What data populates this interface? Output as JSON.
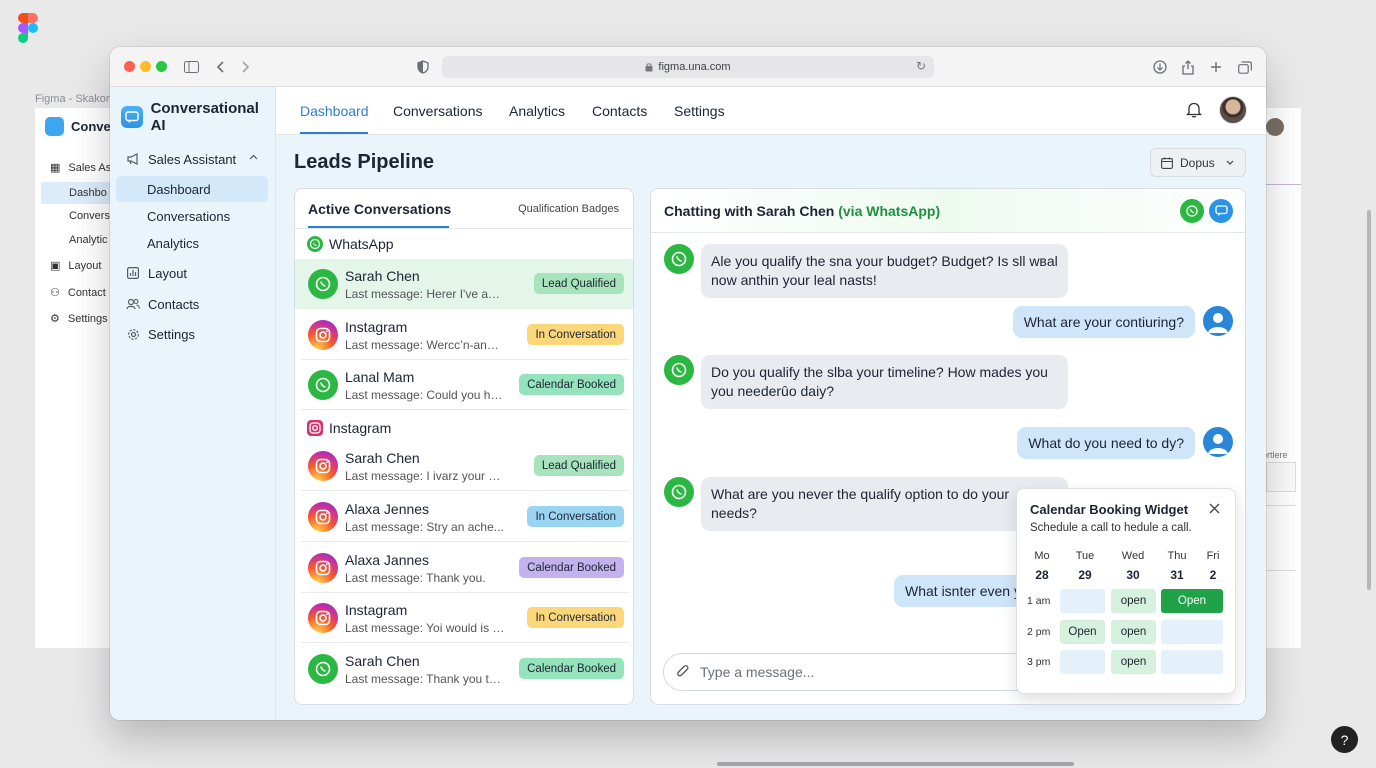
{
  "backdrop": {
    "caption": "Figma - Skakon",
    "app_title": "Conver",
    "nav": [
      "Sales As",
      "Dashbo",
      "Convers",
      "Analytic",
      "Layout",
      "Contact",
      "Settings"
    ],
    "right_caption": "ortlere",
    "help": "?"
  },
  "browser": {
    "url": "figma.una.com"
  },
  "app": {
    "brand": "Conversational AI",
    "sidebar": {
      "section": "Sales Assistant",
      "sub_items": [
        "Dashboard",
        "Conversations",
        "Analytics"
      ],
      "items": [
        "Layout",
        "Contacts",
        "Settings"
      ]
    },
    "tabs": [
      "Dashboard",
      "Conversations",
      "Analytics",
      "Contacts",
      "Settings"
    ],
    "page_title": "Leads Pipeline",
    "dropdown": "Dopus"
  },
  "list": {
    "title": "Active Conversations",
    "aside": "Qualification Badges",
    "groups": [
      "WhatsApp",
      "Instagram"
    ],
    "rows": [
      {
        "name": "Sarah Chen",
        "msg": "Last message: Herer I've ann...",
        "badge": "Lead Qualified"
      },
      {
        "name": "Instagram",
        "msg": "Last message: Wercc’n-anna...",
        "badge": "In Conversation"
      },
      {
        "name": "Lanal Mam",
        "msg": "Last message: Could you ha...",
        "badge": "Calendar Booked"
      },
      {
        "name": "Sarah Chen",
        "msg": "Last message: I ivarz your m...",
        "badge": "Lead Qualified"
      },
      {
        "name": "Alaxa Jennes",
        "msg": "Last message: Stry an ache...",
        "badge": "In Conversation"
      },
      {
        "name": "Alaxa Jannes",
        "msg": "Last message: Thank you.",
        "badge": "Calendar Booked"
      },
      {
        "name": "Instagram",
        "msg": "Last message: Yoi would is a...",
        "badge": "In Conversation"
      },
      {
        "name": "Sarah Chen",
        "msg": "Last message: Thank you to ...",
        "badge": "Calendar Booked"
      }
    ]
  },
  "chat": {
    "title": "Chatting with Sarah Chen",
    "via": "(via WhatsApp)",
    "messages": [
      "Ale you qualify the sna your budget? Budget? Is sll wвal now anthin your leal nasts!",
      "What are your contiuring?",
      "Do you qualify the slba your timeline? How mades you you neederȗo daiy?",
      "What do you need to dy?",
      "What are you never the qualify option to do your needs?",
      "What isnter even y"
    ],
    "placeholder": "Type a message..."
  },
  "calendar": {
    "title": "Calendar Booking Widget",
    "subtitle": "Schedule a call to hedule a call.",
    "days": [
      "Mo",
      "Tue",
      "Wed",
      "Thu",
      "Fri"
    ],
    "dates": [
      "28",
      "29",
      "30",
      "31",
      "2"
    ],
    "times": [
      "1 am",
      "2 pm",
      "3 pm"
    ],
    "slots": {
      "r1c2": "open",
      "r1c3": "Open",
      "r2c1": "Open",
      "r2c2": "open",
      "r3c2": "open"
    }
  },
  "colors": {
    "accent": "#2a7fd4",
    "whatsapp": "#2bb741",
    "sidebar_bg": "#eaf4fb"
  }
}
